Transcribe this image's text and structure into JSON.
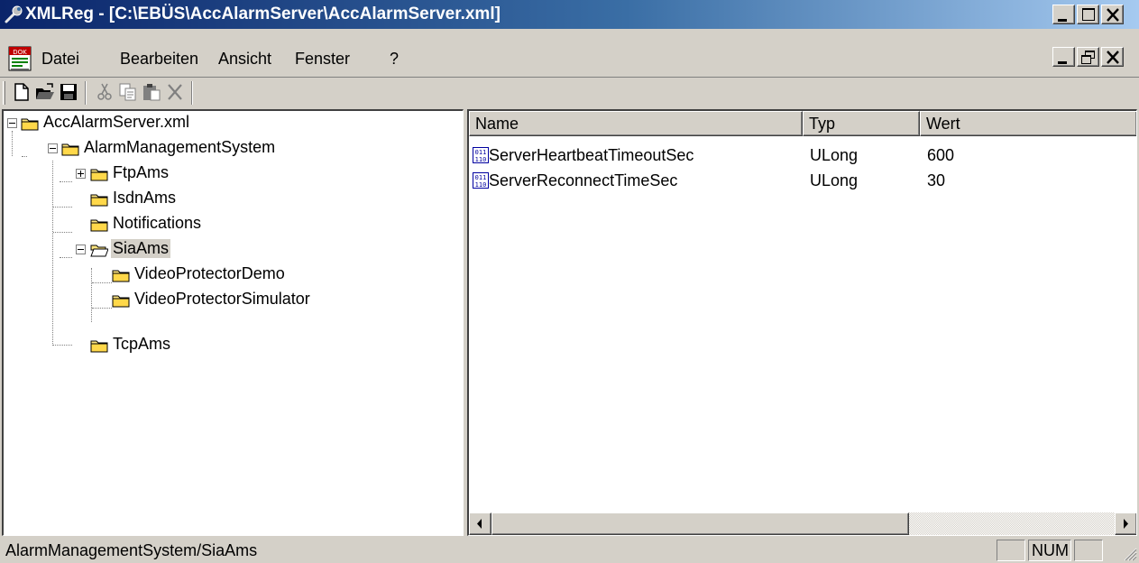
{
  "window": {
    "title": "XMLReg - [C:\\EBÜS\\AccAlarmServer\\AccAlarmServer.xml]"
  },
  "menu": {
    "items": [
      "Datei",
      "Bearbeiten",
      "Ansicht",
      "Fenster",
      "?"
    ]
  },
  "toolbar": {
    "buttons": [
      "new-icon",
      "open-icon",
      "save-icon",
      "cut-icon",
      "copy-icon",
      "paste-icon",
      "delete-icon"
    ]
  },
  "tree": {
    "nodes": [
      {
        "label": "AccAlarmServer.xml",
        "expanded": true
      },
      {
        "label": "AlarmManagementSystem",
        "expanded": true
      },
      {
        "label": "FtpAms",
        "expanded": false
      },
      {
        "label": "IsdnAms"
      },
      {
        "label": "Notifications"
      },
      {
        "label": "SiaAms",
        "expanded": true,
        "selected": true
      },
      {
        "label": "VideoProtectorDemo"
      },
      {
        "label": "VideoProtectorSimulator"
      },
      {
        "label": "TcpAms"
      }
    ]
  },
  "list": {
    "columns": [
      "Name",
      "Typ",
      "Wert"
    ],
    "rows": [
      {
        "name": "ServerHeartbeatTimeoutSec",
        "type": "ULong",
        "value": "600"
      },
      {
        "name": "ServerReconnectTimeSec",
        "type": "ULong",
        "value": "30"
      }
    ]
  },
  "status": {
    "path": "AlarmManagementSystem/SiaAms",
    "num": "NUM"
  },
  "colors": {
    "title_start": "#0a246a",
    "title_end": "#a6caf0",
    "face": "#d4d0c8"
  }
}
